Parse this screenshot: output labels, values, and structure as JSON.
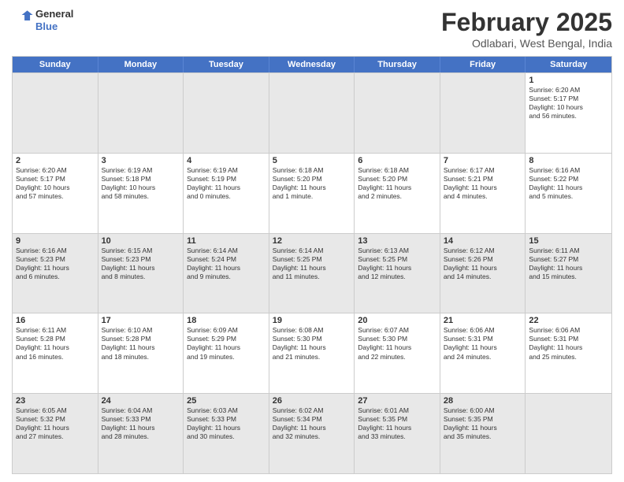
{
  "header": {
    "logo_line1": "General",
    "logo_line2": "Blue",
    "month_year": "February 2025",
    "location": "Odlabari, West Bengal, India"
  },
  "weekdays": [
    "Sunday",
    "Monday",
    "Tuesday",
    "Wednesday",
    "Thursday",
    "Friday",
    "Saturday"
  ],
  "rows": [
    [
      {
        "day": "",
        "info": "",
        "shaded": true
      },
      {
        "day": "",
        "info": "",
        "shaded": true
      },
      {
        "day": "",
        "info": "",
        "shaded": true
      },
      {
        "day": "",
        "info": "",
        "shaded": true
      },
      {
        "day": "",
        "info": "",
        "shaded": true
      },
      {
        "day": "",
        "info": "",
        "shaded": true
      },
      {
        "day": "1",
        "info": "Sunrise: 6:20 AM\nSunset: 5:17 PM\nDaylight: 10 hours\nand 56 minutes.",
        "shaded": false
      }
    ],
    [
      {
        "day": "2",
        "info": "Sunrise: 6:20 AM\nSunset: 5:17 PM\nDaylight: 10 hours\nand 57 minutes.",
        "shaded": false
      },
      {
        "day": "3",
        "info": "Sunrise: 6:19 AM\nSunset: 5:18 PM\nDaylight: 10 hours\nand 58 minutes.",
        "shaded": false
      },
      {
        "day": "4",
        "info": "Sunrise: 6:19 AM\nSunset: 5:19 PM\nDaylight: 11 hours\nand 0 minutes.",
        "shaded": false
      },
      {
        "day": "5",
        "info": "Sunrise: 6:18 AM\nSunset: 5:20 PM\nDaylight: 11 hours\nand 1 minute.",
        "shaded": false
      },
      {
        "day": "6",
        "info": "Sunrise: 6:18 AM\nSunset: 5:20 PM\nDaylight: 11 hours\nand 2 minutes.",
        "shaded": false
      },
      {
        "day": "7",
        "info": "Sunrise: 6:17 AM\nSunset: 5:21 PM\nDaylight: 11 hours\nand 4 minutes.",
        "shaded": false
      },
      {
        "day": "8",
        "info": "Sunrise: 6:16 AM\nSunset: 5:22 PM\nDaylight: 11 hours\nand 5 minutes.",
        "shaded": false
      }
    ],
    [
      {
        "day": "9",
        "info": "Sunrise: 6:16 AM\nSunset: 5:23 PM\nDaylight: 11 hours\nand 6 minutes.",
        "shaded": true
      },
      {
        "day": "10",
        "info": "Sunrise: 6:15 AM\nSunset: 5:23 PM\nDaylight: 11 hours\nand 8 minutes.",
        "shaded": true
      },
      {
        "day": "11",
        "info": "Sunrise: 6:14 AM\nSunset: 5:24 PM\nDaylight: 11 hours\nand 9 minutes.",
        "shaded": true
      },
      {
        "day": "12",
        "info": "Sunrise: 6:14 AM\nSunset: 5:25 PM\nDaylight: 11 hours\nand 11 minutes.",
        "shaded": true
      },
      {
        "day": "13",
        "info": "Sunrise: 6:13 AM\nSunset: 5:25 PM\nDaylight: 11 hours\nand 12 minutes.",
        "shaded": true
      },
      {
        "day": "14",
        "info": "Sunrise: 6:12 AM\nSunset: 5:26 PM\nDaylight: 11 hours\nand 14 minutes.",
        "shaded": true
      },
      {
        "day": "15",
        "info": "Sunrise: 6:11 AM\nSunset: 5:27 PM\nDaylight: 11 hours\nand 15 minutes.",
        "shaded": true
      }
    ],
    [
      {
        "day": "16",
        "info": "Sunrise: 6:11 AM\nSunset: 5:28 PM\nDaylight: 11 hours\nand 16 minutes.",
        "shaded": false
      },
      {
        "day": "17",
        "info": "Sunrise: 6:10 AM\nSunset: 5:28 PM\nDaylight: 11 hours\nand 18 minutes.",
        "shaded": false
      },
      {
        "day": "18",
        "info": "Sunrise: 6:09 AM\nSunset: 5:29 PM\nDaylight: 11 hours\nand 19 minutes.",
        "shaded": false
      },
      {
        "day": "19",
        "info": "Sunrise: 6:08 AM\nSunset: 5:30 PM\nDaylight: 11 hours\nand 21 minutes.",
        "shaded": false
      },
      {
        "day": "20",
        "info": "Sunrise: 6:07 AM\nSunset: 5:30 PM\nDaylight: 11 hours\nand 22 minutes.",
        "shaded": false
      },
      {
        "day": "21",
        "info": "Sunrise: 6:06 AM\nSunset: 5:31 PM\nDaylight: 11 hours\nand 24 minutes.",
        "shaded": false
      },
      {
        "day": "22",
        "info": "Sunrise: 6:06 AM\nSunset: 5:31 PM\nDaylight: 11 hours\nand 25 minutes.",
        "shaded": false
      }
    ],
    [
      {
        "day": "23",
        "info": "Sunrise: 6:05 AM\nSunset: 5:32 PM\nDaylight: 11 hours\nand 27 minutes.",
        "shaded": true
      },
      {
        "day": "24",
        "info": "Sunrise: 6:04 AM\nSunset: 5:33 PM\nDaylight: 11 hours\nand 28 minutes.",
        "shaded": true
      },
      {
        "day": "25",
        "info": "Sunrise: 6:03 AM\nSunset: 5:33 PM\nDaylight: 11 hours\nand 30 minutes.",
        "shaded": true
      },
      {
        "day": "26",
        "info": "Sunrise: 6:02 AM\nSunset: 5:34 PM\nDaylight: 11 hours\nand 32 minutes.",
        "shaded": true
      },
      {
        "day": "27",
        "info": "Sunrise: 6:01 AM\nSunset: 5:35 PM\nDaylight: 11 hours\nand 33 minutes.",
        "shaded": true
      },
      {
        "day": "28",
        "info": "Sunrise: 6:00 AM\nSunset: 5:35 PM\nDaylight: 11 hours\nand 35 minutes.",
        "shaded": true
      },
      {
        "day": "",
        "info": "",
        "shaded": true
      }
    ]
  ]
}
